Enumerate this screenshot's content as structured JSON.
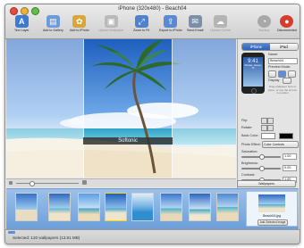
{
  "window": {
    "title": "iPhone (320x480) - Beach04"
  },
  "toolbar": {
    "text_layer": "Text Layer",
    "add_gallery": "Add to Gallery",
    "add_iphoto": "Add to iPhoto",
    "upload_wallpaper": "Upload Wallpaper",
    "zoom_fit": "Zoom to Fit",
    "export_iphoto": "Export to iPhoto",
    "send_email": "Send Email",
    "upload_online": "Upload Online",
    "backup": "Backup",
    "disconnected": "Disconnected"
  },
  "canvas": {
    "watermark": "Softonic"
  },
  "right_panel": {
    "tabs": [
      "iPhone",
      "iPad"
    ],
    "name_label": "Name:",
    "name_value": "Beach04",
    "preview_mode_label": "Preview Mode:",
    "display_label": "Display",
    "hint": "Drag wallpaper here to place, or use the arrows to position",
    "flip_label": "Flip:",
    "rotate_label": "Rotate:",
    "back_color_label": "Back Color:",
    "photo_effect_label": "Photo Effect:",
    "photo_effect_value": "Color Controls",
    "saturation_label": "Saturation:",
    "saturation_value": "1.00",
    "brightness_label": "Brightness:",
    "brightness_value": "0.00",
    "contrast_label": "Contrast:",
    "contrast_value": "1.00",
    "lock_time": "9:41",
    "lock_date": "Monday, January 13"
  },
  "wallpapers_dropdown": "Wallpapers",
  "gallery": {
    "caption": "Beach04.jpg",
    "button": "Add Selected Image"
  },
  "status": {
    "text": "Selected: 120 wallpapers (13.81 MB)"
  },
  "colors": {
    "accent": "#5d8fd6",
    "strip": "#7aa9df"
  }
}
